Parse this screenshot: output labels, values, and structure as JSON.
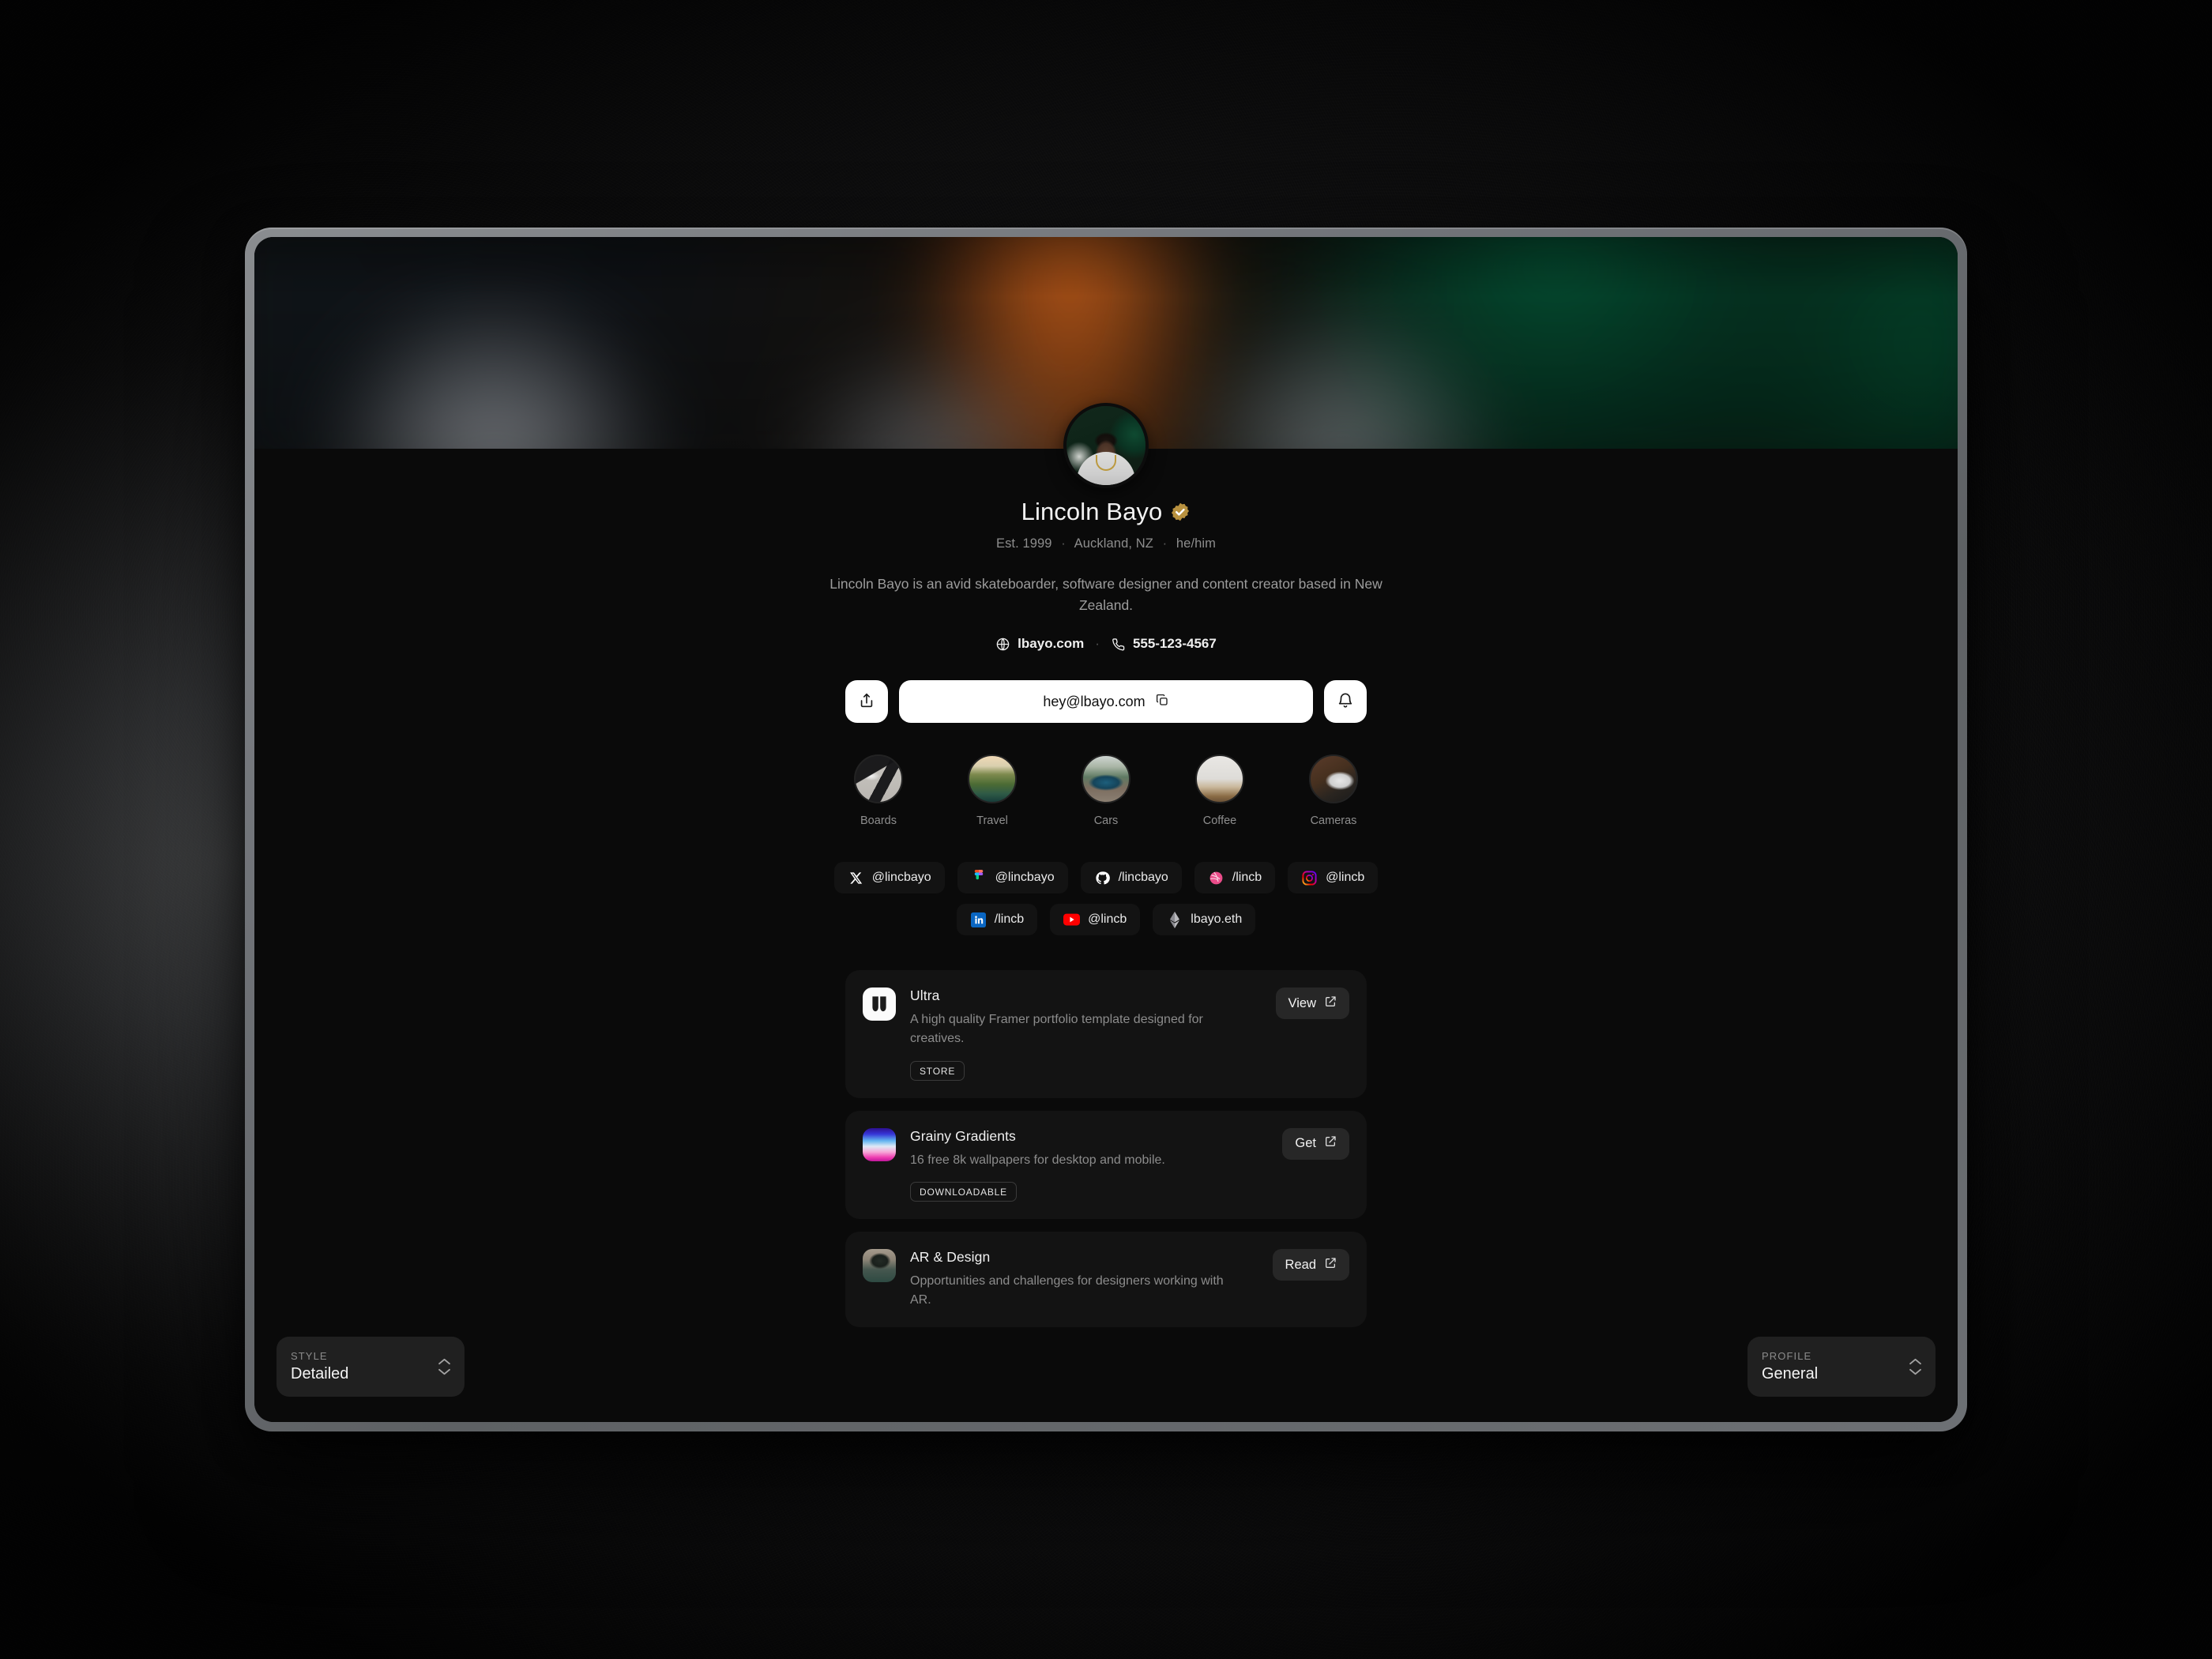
{
  "profile": {
    "display_name": "Lincoln Bayo",
    "verified_badge": "verified-check-icon",
    "meta": {
      "established": "Est. 1999",
      "location": "Auckland, NZ",
      "pronouns": "he/him",
      "separator": "·"
    },
    "bio": "Lincoln Bayo is an avid skateboarder, software designer and content creator based in New Zealand.",
    "contact": {
      "website": "lbayo.com",
      "phone": "555-123-4567",
      "separator": "·"
    }
  },
  "actions": {
    "share_icon": "share-icon",
    "email": "hey@lbayo.com",
    "copy_icon": "copy-icon",
    "notify_icon": "bell-icon"
  },
  "highlights": [
    {
      "label": "Boards",
      "art": "hl-boards"
    },
    {
      "label": "Travel",
      "art": "hl-travel"
    },
    {
      "label": "Cars",
      "art": "hl-cars"
    },
    {
      "label": "Coffee",
      "art": "hl-coffee"
    },
    {
      "label": "Cameras",
      "art": "hl-cameras"
    }
  ],
  "socials": [
    {
      "icon": "x-icon",
      "handle": "@lincbayo"
    },
    {
      "icon": "figma-icon",
      "handle": "@lincbayo"
    },
    {
      "icon": "github-icon",
      "handle": "/lincbayo"
    },
    {
      "icon": "dribbble-icon",
      "handle": "/lincb"
    },
    {
      "icon": "instagram-icon",
      "handle": "@lincb"
    },
    {
      "icon": "linkedin-icon",
      "handle": "/lincb"
    },
    {
      "icon": "youtube-icon",
      "handle": "@lincb"
    },
    {
      "icon": "ethereum-icon",
      "handle": "lbayo.eth"
    }
  ],
  "cards": [
    {
      "title": "Ultra",
      "description": "A high quality Framer portfolio template designed for creatives.",
      "badge": "STORE",
      "button": "View",
      "button_icon": "external-link-icon",
      "icon": "ultra-logo-icon"
    },
    {
      "title": "Grainy Gradients",
      "description": "16 free 8k wallpapers for desktop and mobile.",
      "badge": "DOWNLOADABLE",
      "button": "Get",
      "button_icon": "external-link-icon",
      "icon": "gradient-thumbnail"
    },
    {
      "title": "AR & Design",
      "description": "Opportunities and challenges for designers working with AR.",
      "badge": "",
      "button": "Read",
      "button_icon": "external-link-icon",
      "icon": "ar-photo-thumbnail"
    }
  ],
  "controls": {
    "style": {
      "label": "STYLE",
      "value": "Detailed",
      "chevron_icon": "chevron-up-down-icon"
    },
    "profile": {
      "label": "PROFILE",
      "value": "General",
      "chevron_icon": "chevron-up-down-icon"
    }
  },
  "colors": {
    "page_bg": "#0a0a0a",
    "card_bg": "#131313",
    "badge_gold": "#b8913f",
    "accent_white": "#ffffff"
  }
}
